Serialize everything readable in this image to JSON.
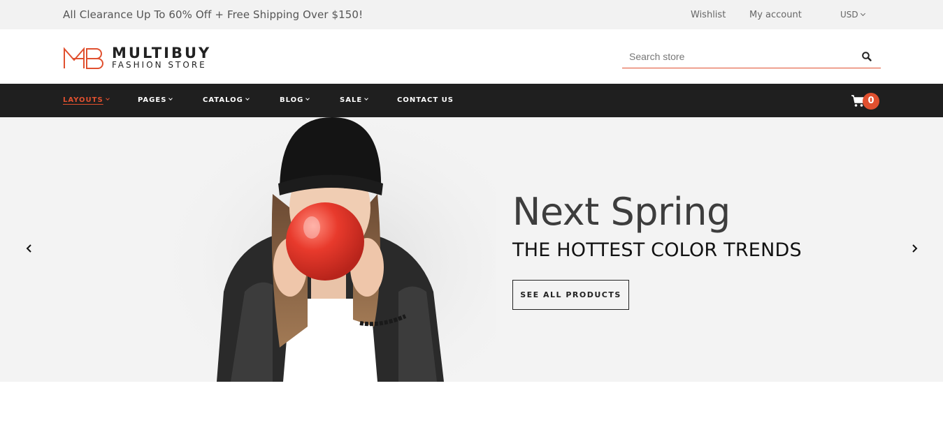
{
  "topbar": {
    "promo": "All Clearance Up To 60% Off + Free Shipping Over $150!",
    "wishlist": "Wishlist",
    "account": "My account",
    "currency": "USD"
  },
  "header": {
    "logo_name": "MULTIBUY",
    "logo_tagline": "FASHION STORE",
    "search_placeholder": "Search store"
  },
  "nav": {
    "items": [
      {
        "label": "LAYOUTS",
        "active": true,
        "dropdown": true
      },
      {
        "label": "PAGES",
        "dropdown": true
      },
      {
        "label": "CATALOG",
        "dropdown": true
      },
      {
        "label": "BLOG",
        "dropdown": true
      },
      {
        "label": "SALE",
        "dropdown": true
      },
      {
        "label": "CONTACT US",
        "dropdown": false
      }
    ],
    "cart_count": "0"
  },
  "hero": {
    "title": "Next Spring",
    "subtitle": "THE HOTTEST COLOR TRENDS",
    "button": "SEE ALL PRODUCTS"
  },
  "colors": {
    "accent": "#e0502f",
    "nav_bg": "#1f1f1f",
    "topbar_bg": "#f2f2f2",
    "hero_bg": "#f3f3f3"
  },
  "icons": [
    "chevron-down-icon",
    "search-icon",
    "cart-icon",
    "arrow-left-icon",
    "arrow-right-icon",
    "logo-mark-icon"
  ]
}
